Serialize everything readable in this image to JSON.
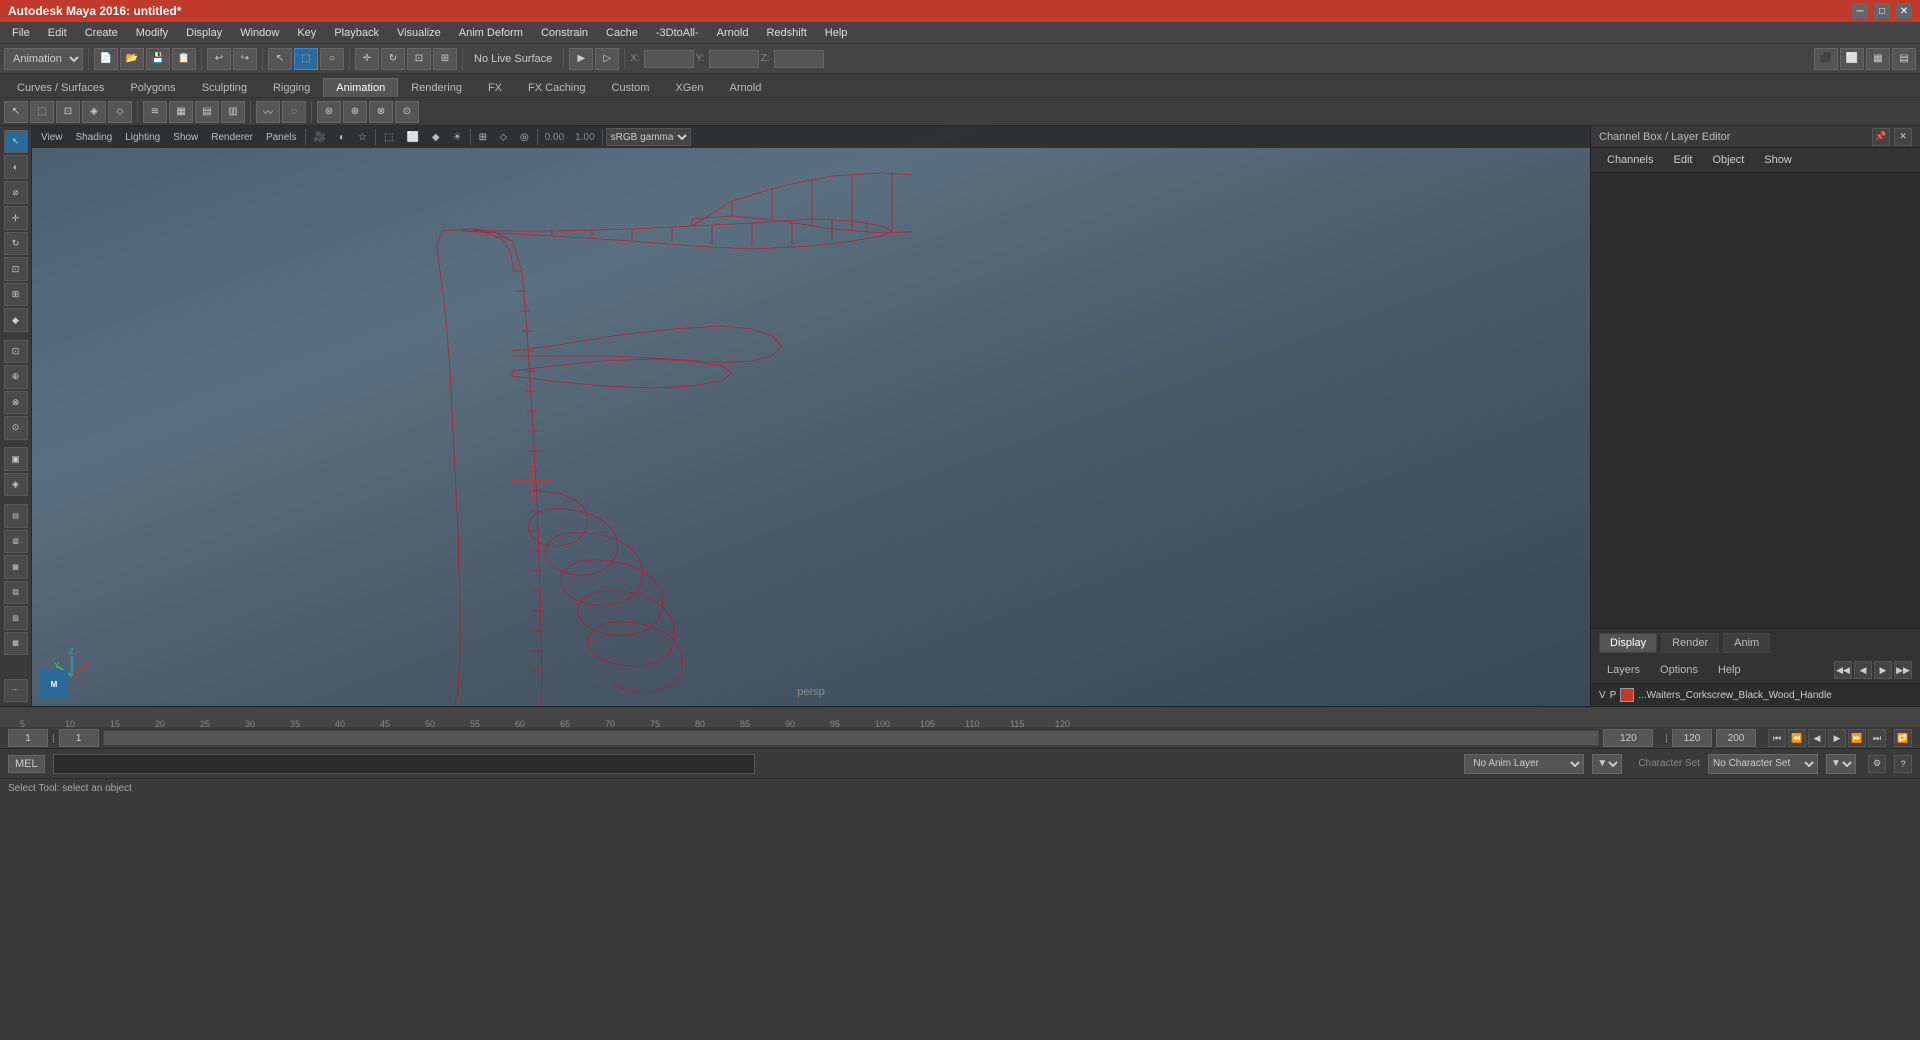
{
  "titleBar": {
    "title": "Autodesk Maya 2016: untitled*",
    "minimizeLabel": "─",
    "maximizeLabel": "□",
    "closeLabel": "✕"
  },
  "menuBar": {
    "items": [
      "File",
      "Edit",
      "Create",
      "Modify",
      "Display",
      "Window",
      "Key",
      "Playback",
      "Visualize",
      "Anim Deform",
      "Constrain",
      "Cache",
      "-3DtoAll-",
      "Arnold",
      "Redshift",
      "Help"
    ]
  },
  "toolbar1": {
    "workspaceDropdown": "Animation",
    "noLiveSurface": "No Live Surface"
  },
  "tabs": {
    "items": [
      "Curves / Surfaces",
      "Polygons",
      "Sculpting",
      "Rigging",
      "Animation",
      "Rendering",
      "FX",
      "FX Caching",
      "Custom",
      "XGen",
      "Arnold"
    ],
    "active": "Animation"
  },
  "viewport": {
    "menuItems": [
      "View",
      "Shading",
      "Lighting",
      "Show",
      "Renderer",
      "Panels"
    ],
    "perspLabel": "persp",
    "gammaLabel": "sRGB gamma",
    "coordX": "",
    "coordY": "",
    "coordZ": ""
  },
  "rightPanel": {
    "title": "Channel Box / Layer Editor",
    "tabs": [
      "Channels",
      "Edit",
      "Object",
      "Show"
    ],
    "displayTabs": [
      "Display",
      "Render",
      "Anim"
    ],
    "layerTabs": [
      "Layers",
      "Options",
      "Help"
    ],
    "layerItem": {
      "v": "V",
      "p": "P",
      "name": "...Waiters_Corkscrew_Black_Wood_Handle"
    }
  },
  "timeline": {
    "ticks": [
      "5",
      "10",
      "15",
      "20",
      "25",
      "30",
      "35",
      "40",
      "45",
      "50",
      "55",
      "60",
      "65",
      "70",
      "75",
      "80",
      "85",
      "90",
      "95",
      "100",
      "105",
      "110",
      "115",
      "120"
    ],
    "currentFrame": "1",
    "startFrame": "1",
    "endFrame": "120",
    "rangeStart": "120",
    "rangeEnd": "200"
  },
  "bottomBar": {
    "melLabel": "MEL",
    "commandPlaceholder": "Select Tool: select an object",
    "noAnimLayer": "No Anim Layer",
    "noCharacterSet": "No Character Set",
    "characterSetLabel": "Character Set"
  },
  "leftToolbar": {
    "tools": [
      "▶",
      "↔",
      "↕",
      "⟲",
      "⬜",
      "◈",
      "✦",
      "⬡",
      "⬢",
      "◐",
      "◑",
      "◒",
      "◓",
      "⊕",
      "⊗",
      "◆",
      "◇",
      "▣",
      "◉",
      "○",
      "⊞",
      "⊟",
      "⊠",
      "⊡",
      "⋯"
    ]
  }
}
